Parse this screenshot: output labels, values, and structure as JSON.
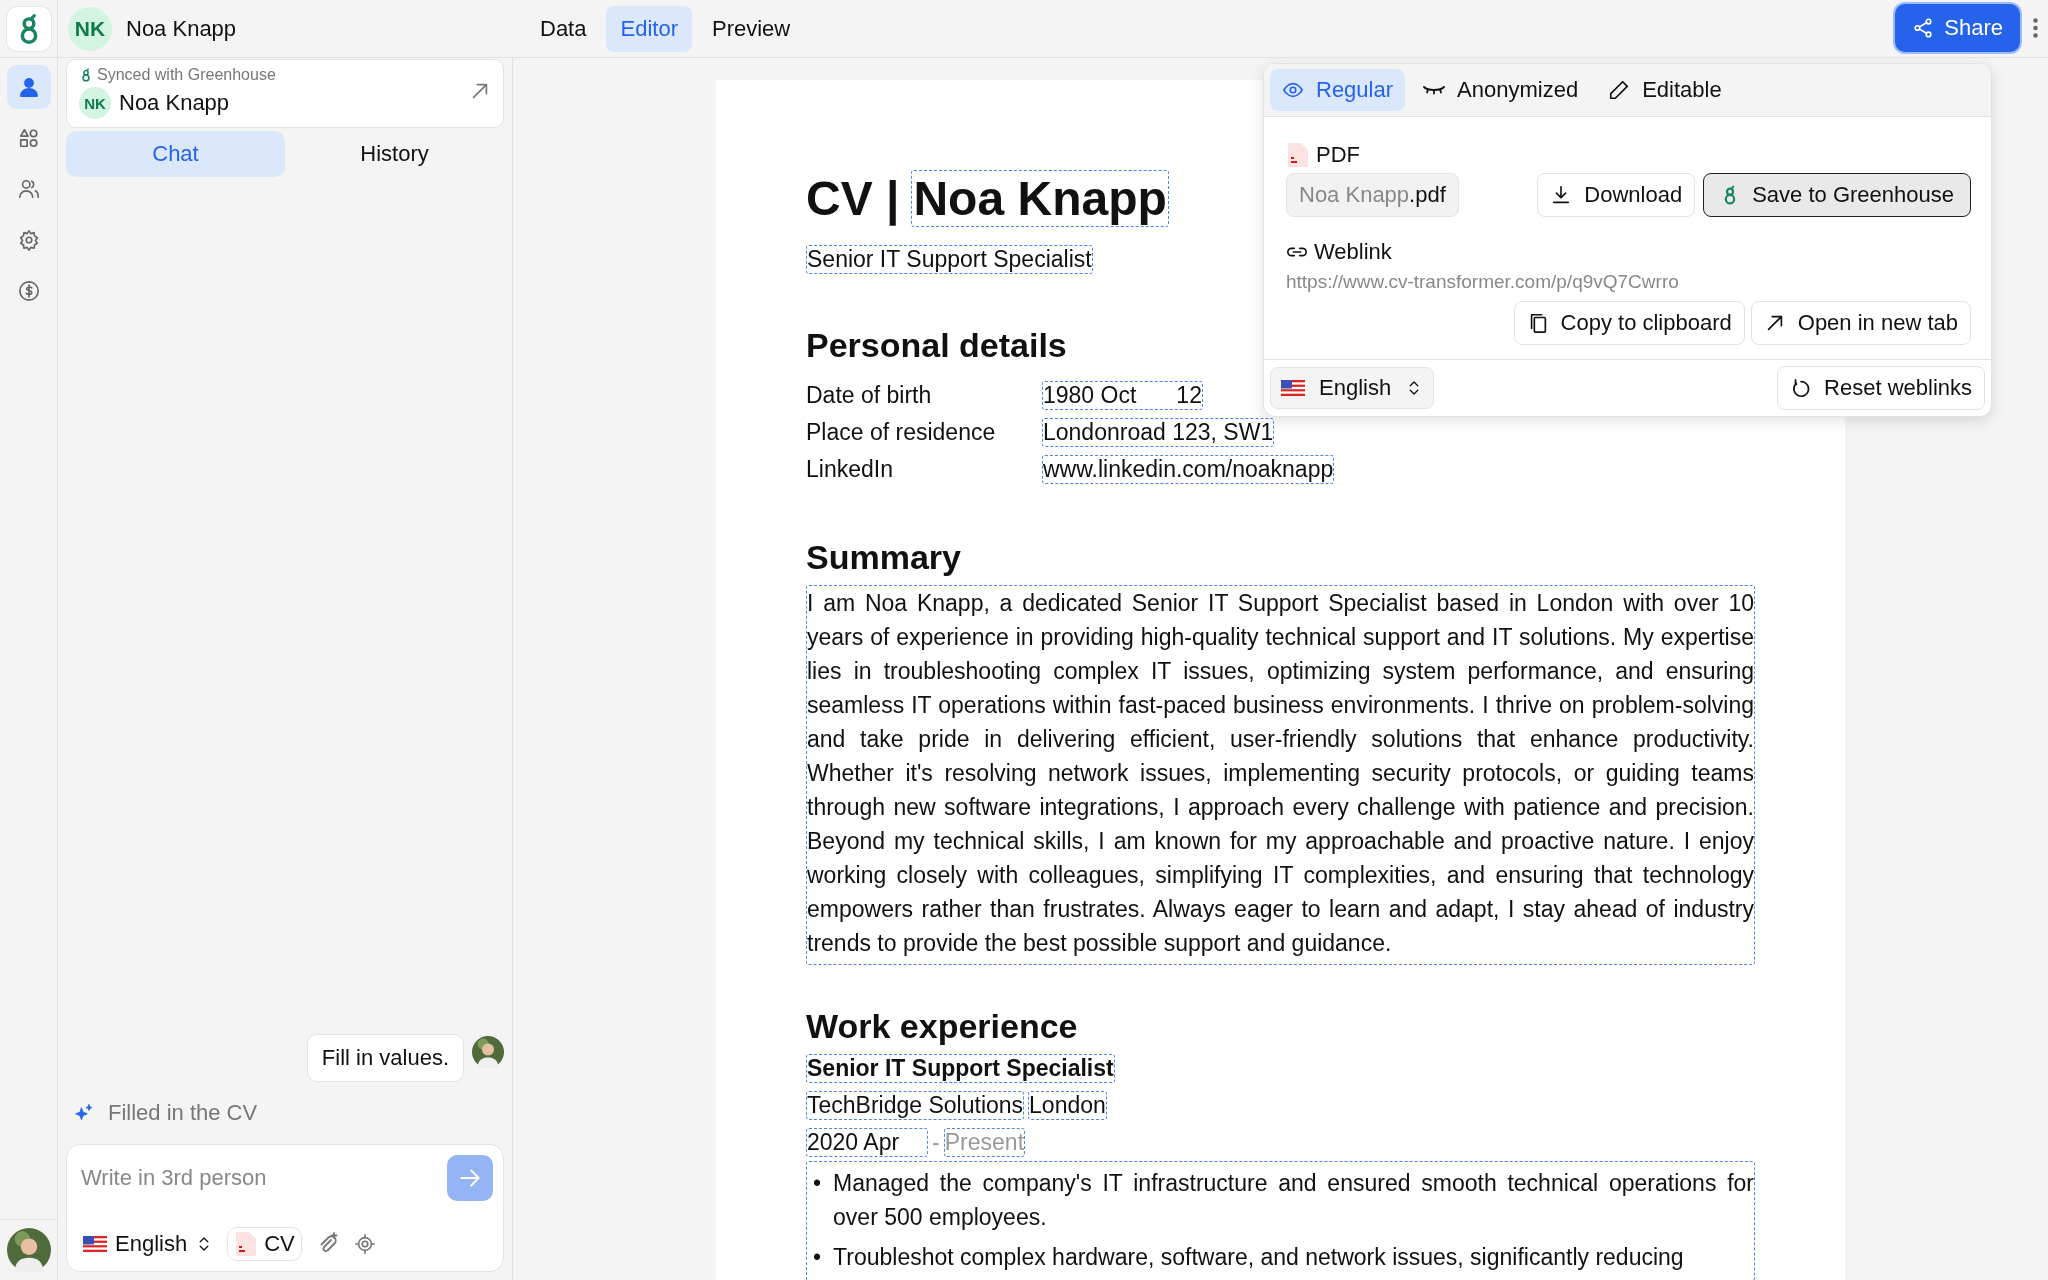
{
  "header": {
    "initials": "NK",
    "name": "Noa Knapp"
  },
  "nav_tabs": [
    {
      "label": "Data",
      "selected": false
    },
    {
      "label": "Editor",
      "selected": true
    },
    {
      "label": "Preview",
      "selected": false
    }
  ],
  "share_button": "Share",
  "rail_items": [
    {
      "kind": "person",
      "selected": true
    },
    {
      "kind": "shapes",
      "selected": false
    },
    {
      "kind": "people",
      "selected": false
    },
    {
      "kind": "settings",
      "selected": false
    },
    {
      "kind": "billing",
      "selected": false
    }
  ],
  "candidate_card": {
    "sync_label": "Synced with Greenhouse",
    "initials": "NK",
    "name": "Noa Knapp"
  },
  "panel_tabs": [
    {
      "label": "Chat",
      "selected": true
    },
    {
      "label": "History",
      "selected": false
    }
  ],
  "chat": {
    "user_message": "Fill in values.",
    "status": "Filled in the CV"
  },
  "composer": {
    "placeholder": "Write in 3rd person",
    "language": "English",
    "attachment": "CV"
  },
  "document": {
    "title_prefix": "CV |",
    "name": "Noa Knapp",
    "headline": "Senior IT Support Specialist",
    "personal_heading": "Personal details",
    "personal_rows": [
      {
        "label": "Date of birth",
        "value": "1980 Oct",
        "value_2": "12"
      },
      {
        "label": "Place of residence",
        "value": "Londonroad 123, SW1"
      },
      {
        "label": "LinkedIn",
        "value": "www.linkedin.com/noaknapp"
      }
    ],
    "summary_heading": "Summary",
    "summary": "I am Noa Knapp, a dedicated Senior IT Support Specialist based in London with over 10 years of experience in providing high-quality technical support and IT solutions. My expertise lies in troubleshooting complex IT issues, optimizing system performance, and ensuring seamless IT operations within fast-paced business environments. I thrive on problem-solving and take pride in delivering efficient, user-friendly solutions that enhance productivity. Whether it's resolving network issues, implementing security protocols, or guiding teams through new software integrations, I approach every challenge with patience and precision. Beyond my technical skills, I am known for my approachable and proactive nature. I enjoy working closely with colleagues, simplifying IT complexities, and ensuring that technology empowers rather than frustrates. Always eager to learn and adapt, I stay ahead of industry trends to provide the best possible support and guidance.",
    "work_heading": "Work experience",
    "job": {
      "title": "Senior IT Support Specialist",
      "company": "TechBridge Solutions",
      "city": "London",
      "start": "2020 Apr",
      "separator": "-",
      "end": "Present",
      "marker": "•",
      "bullets": [
        "Managed the company's IT infrastructure and ensured smooth technical operations for over 500 employees.",
        "Troubleshot complex hardware, software, and network issues, significantly reducing"
      ]
    }
  },
  "share_popup": {
    "modes": [
      {
        "kind": "regular",
        "label": "Regular",
        "selected": true
      },
      {
        "kind": "anonymized",
        "label": "Anonymized",
        "selected": false
      },
      {
        "kind": "editable",
        "label": "Editable",
        "selected": false
      }
    ],
    "pdf_heading": "PDF",
    "file_stem": "Noa Knapp",
    "file_ext": ".pdf",
    "download": "Download",
    "save": "Save to Greenhouse",
    "weblink_heading": "Weblink",
    "url": "https://www.cv-transformer.com/p/q9vQ7Cwrro",
    "copy": "Copy to clipboard",
    "open": "Open in new tab",
    "language": "English",
    "reset": "Reset weblinks"
  }
}
